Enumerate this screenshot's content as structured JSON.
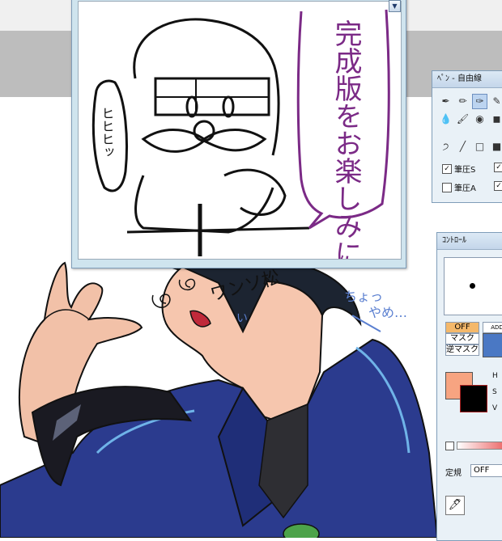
{
  "preview": {
    "dropdown_icon": "chevron-down-icon",
    "speech_text": "完成版をお楽しみにぃ",
    "laugh_text": "ヒヒヒッ"
  },
  "artwork": {
    "face_text": "ワンソ松",
    "face_sub": "い",
    "side_text_1": "ちょっ",
    "side_text_2": "やめ…"
  },
  "pen_palette": {
    "title": "ﾍﾟﾝ - 自由線",
    "options": [
      {
        "label": "筆圧S",
        "checked": true
      },
      {
        "label": "筆圧A",
        "checked": false
      }
    ]
  },
  "control_palette": {
    "title": "ｺﾝﾄﾛｰﾙ",
    "off_label": "OFF",
    "mask_label": "マスク",
    "inverse_mask_label": "逆マスク",
    "add_label": "ADD",
    "h_label": "H",
    "s_label": "S",
    "v_label": "V",
    "fixed_label": "定規",
    "fixed_value": "OFF",
    "colors": {
      "main": "#f7a481",
      "sub": "#000000",
      "selected": "#4a78c4",
      "off_button": "#f4b86a"
    }
  }
}
